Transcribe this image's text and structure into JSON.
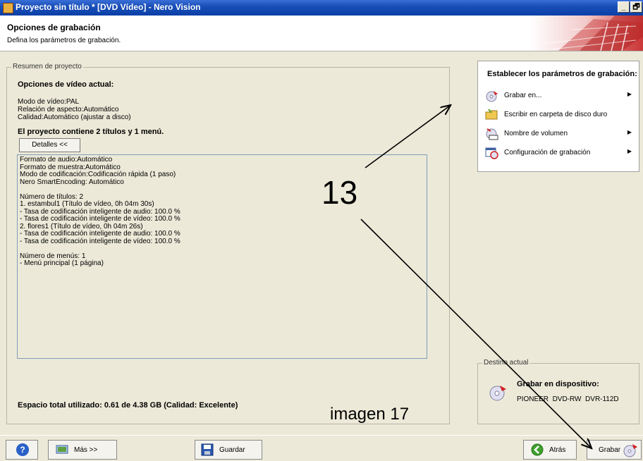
{
  "window": {
    "title": "Proyecto sin título * [DVD Vídeo] - Nero Vision",
    "minimize_label": "_",
    "restore_label": "🗗"
  },
  "header": {
    "title": "Opciones de grabación",
    "subtitle": "Defina los parámetros de grabación."
  },
  "summary": {
    "legend": "Resumen de proyecto",
    "video_options_heading": "Opciones de vídeo actual:",
    "video_mode": "Modo de vídeo:PAL",
    "aspect_ratio": "Relación de aspecto:Automático",
    "quality": "Calidad:Automático (ajustar a disco)",
    "contents_heading": "El proyecto contiene 2 títulos y 1 menú.",
    "details_button": "Detalles <<",
    "details_lines": [
      "Formato de audio:Automático",
      "Formato de muestra:Automático",
      "Modo de codificación:Codificación rápida (1 paso)",
      "Nero SmartEncoding: Automático",
      "",
      "Número de títulos: 2",
      "1. estambul1 (Título de vídeo, 0h 04m 30s)",
      "- Tasa de codificación inteligente de audio: 100.0 %",
      "- Tasa de codificación inteligente de vídeo: 100.0 %",
      "2. flores1 (Título de vídeo, 0h 04m 26s)",
      "- Tasa de codificación inteligente de audio: 100.0 %",
      "- Tasa de codificación inteligente de vídeo: 100.0 %",
      "",
      "Número de menús: 1",
      "- Menú principal (1 página)"
    ],
    "space_used": "Espacio total utilizado: 0.61 de 4.38 GB (Calidad: Excelente)"
  },
  "params_panel": {
    "title": "Establecer los parámetros de grabación:",
    "items": [
      {
        "label": "Grabar en...",
        "icon": "burn-disc-icon",
        "has_submenu": true
      },
      {
        "label": "Escribir en carpeta de disco duro",
        "icon": "folder-icon",
        "has_submenu": false
      },
      {
        "label": "Nombre de volumen",
        "icon": "volume-label-icon",
        "has_submenu": true
      },
      {
        "label": "Configuración de grabación",
        "icon": "burn-settings-icon",
        "has_submenu": true
      }
    ]
  },
  "destination": {
    "legend": "Destino actual",
    "heading": "Grabar en dispositivo:",
    "device": "PIONEER  DVD-RW  DVR-112D"
  },
  "bottombar": {
    "help_label": "?",
    "more_label": "Más >>",
    "save_label": "Guardar",
    "back_label": "Atrás",
    "burn_label": "Grabar"
  },
  "annotations": {
    "step_number": "13",
    "image_label": "imagen 17"
  }
}
